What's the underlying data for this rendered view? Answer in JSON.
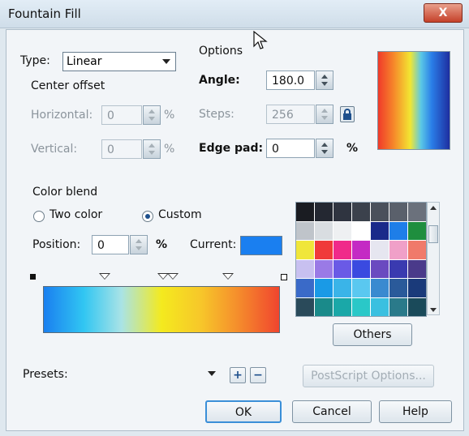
{
  "window": {
    "title": "Fountain Fill",
    "close_glyph": "X"
  },
  "type": {
    "label": "Type:",
    "value": "Linear"
  },
  "center_offset": {
    "heading": "Center offset",
    "horizontal_label": "Horizontal:",
    "horizontal_value": "0",
    "vertical_label": "Vertical:",
    "vertical_value": "0",
    "unit": "%"
  },
  "options": {
    "heading": "Options",
    "angle_label": "Angle:",
    "angle_value": "180.0",
    "steps_label": "Steps:",
    "steps_value": "256",
    "edge_pad_label": "Edge pad:",
    "edge_pad_value": "0",
    "unit": "%"
  },
  "color_blend": {
    "heading": "Color blend",
    "two_color_label": "Two color",
    "custom_label": "Custom",
    "selected": "custom",
    "position_label": "Position:",
    "position_value": "0",
    "position_unit": "%",
    "current_label": "Current:",
    "current_color": "#1a7ff0",
    "gradient_stops": [
      "#1a7ff0",
      "#31c6f2",
      "#a9e3e6",
      "#f4ea1e",
      "#f7c62a",
      "#f58b2c",
      "#f0452e"
    ]
  },
  "palette": {
    "colors": [
      "#1a1c22",
      "#242832",
      "#2f3440",
      "#3b414c",
      "#4a505b",
      "#5a606b",
      "#6b717c",
      "#bfc4ca",
      "#d9dde1",
      "#eef0f2",
      "#ffffff",
      "#1a2a8a",
      "#1e7ee8",
      "#1f8e3e",
      "#f0e63a",
      "#f03a3a",
      "#f02a8a",
      "#c42ac4",
      "#e6e6f0",
      "#f0a0c8",
      "#f07a6a",
      "#c8c0f0",
      "#9a7ae6",
      "#6a5ae6",
      "#3a4ae0",
      "#6a4ac0",
      "#3a3ab0",
      "#4a3a8a",
      "#3a6ac8",
      "#1a9ae6",
      "#3ab4e8",
      "#5ac8f0",
      "#3a8ad0",
      "#2a5a9a",
      "#1a3a7a",
      "#2a4a5a",
      "#1a8a8a",
      "#1aa8a8",
      "#2ac8c8",
      "#3ac0e0",
      "#2a7a8a",
      "#1a4a5a"
    ],
    "others_label": "Others"
  },
  "presets": {
    "label": "Presets:",
    "value": "",
    "add_icon": "+",
    "remove_icon": "−"
  },
  "buttons": {
    "postscript": "PostScript Options...",
    "ok": "OK",
    "cancel": "Cancel",
    "help": "Help"
  }
}
